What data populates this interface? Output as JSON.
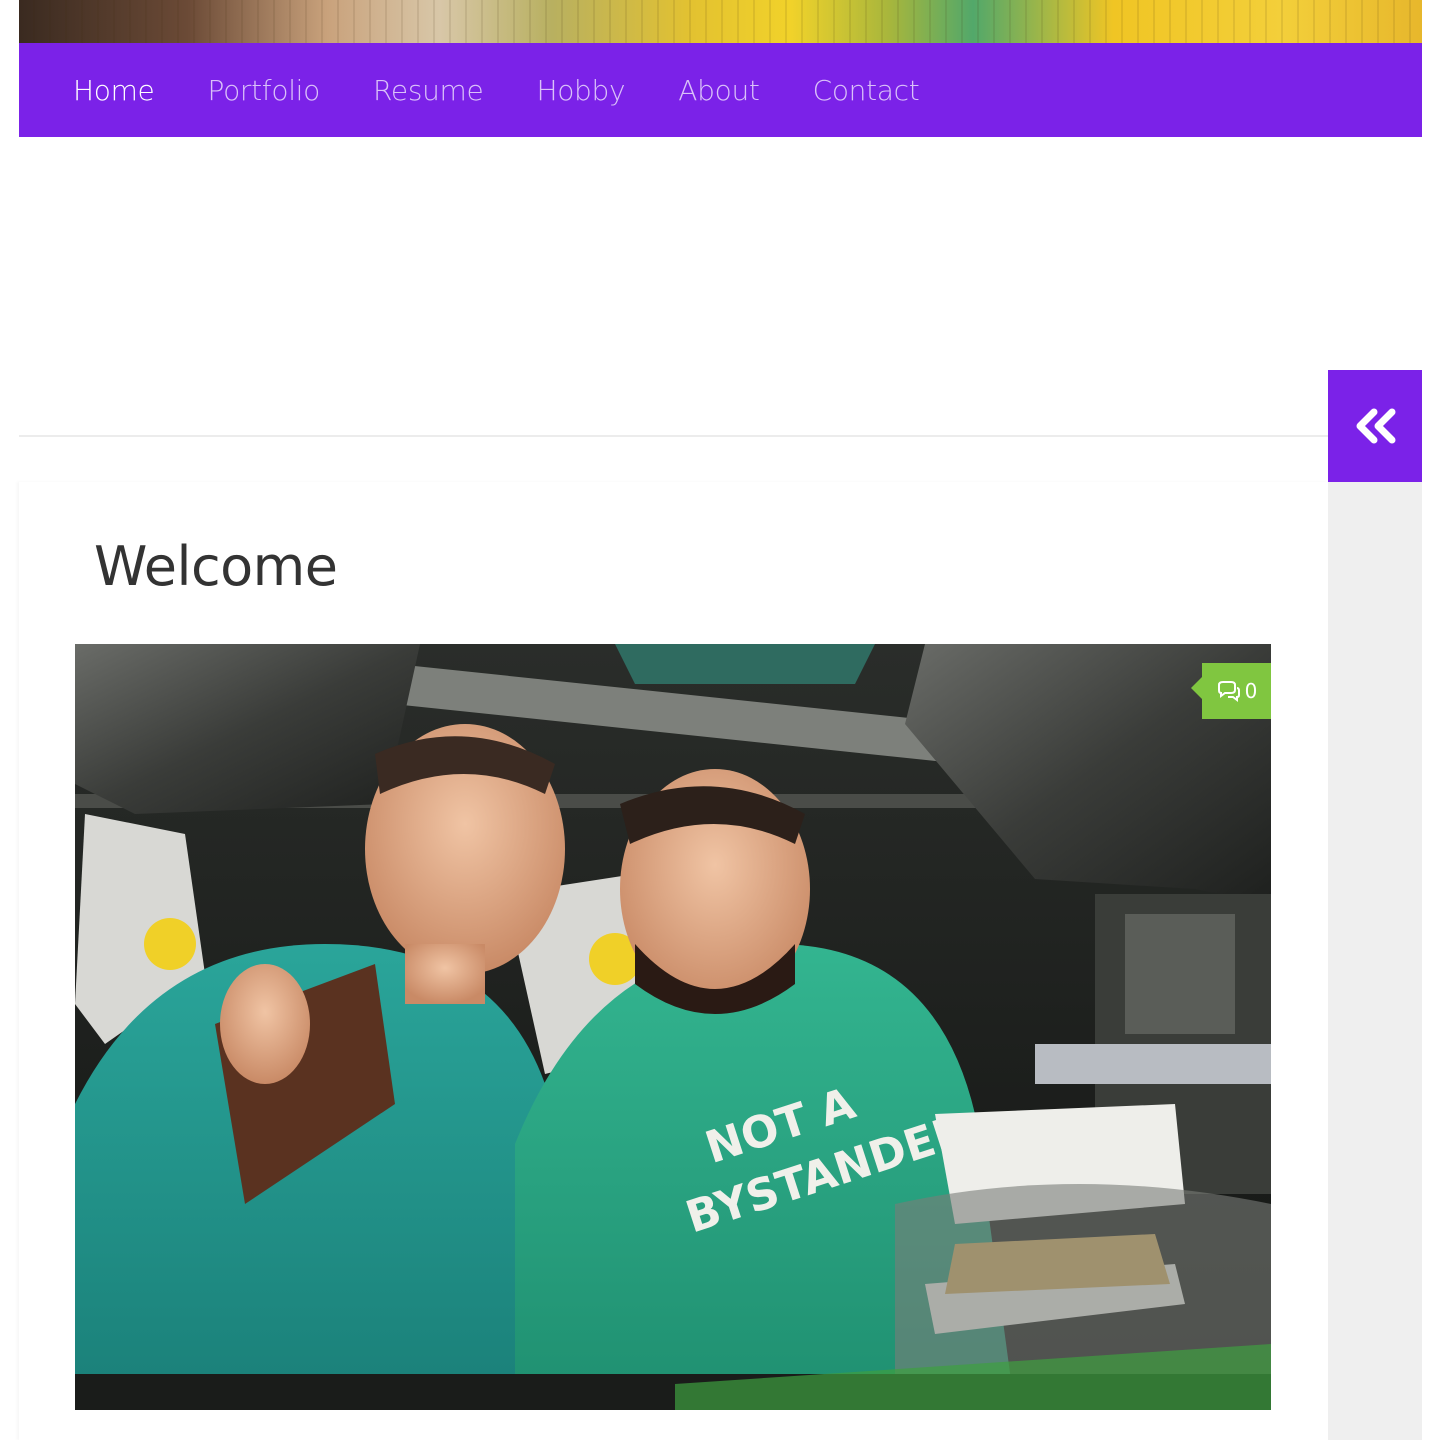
{
  "header": {
    "image_alt": ""
  },
  "nav": {
    "items": [
      {
        "label": "Home",
        "active": true
      },
      {
        "label": "Portfolio",
        "active": false
      },
      {
        "label": "Resume",
        "active": false
      },
      {
        "label": "Hobby",
        "active": false
      },
      {
        "label": "About",
        "active": false
      },
      {
        "label": "Contact",
        "active": false
      }
    ],
    "color": "#7b22e8"
  },
  "sidebar": {
    "toggle_icon": "double-chevron-left-icon"
  },
  "main": {
    "title": "Welcome",
    "featured_image": {
      "comment_count": "0",
      "comment_icon": "comments-icon",
      "shirt_text_line1": "NOT A",
      "shirt_text_line2": "BYSTANDER",
      "badge_color": "#80c640"
    }
  }
}
